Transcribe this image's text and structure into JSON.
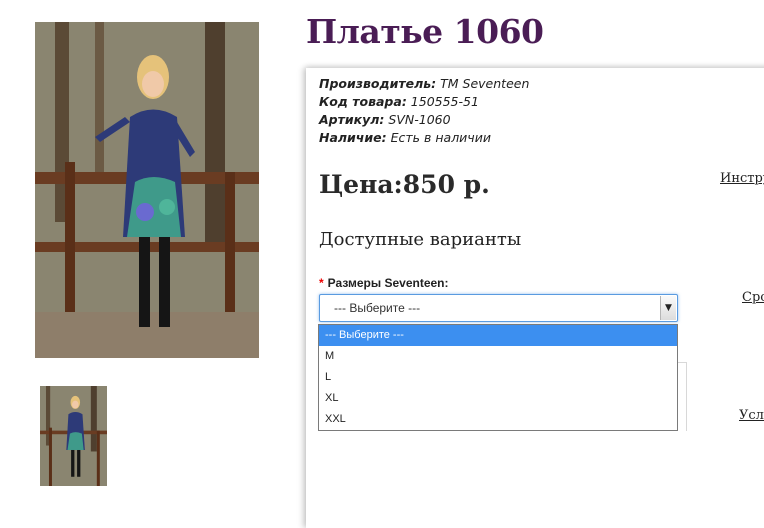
{
  "product": {
    "title": "Платье 1060",
    "meta": [
      {
        "label": "Производитель:",
        "value": "ТМ Seventeen"
      },
      {
        "label": "Код товара:",
        "value": "150555-51"
      },
      {
        "label": "Артикул:",
        "value": "SVN-1060"
      },
      {
        "label": "Наличие:",
        "value": "Есть в наличии"
      }
    ],
    "price": "Цена:850 р."
  },
  "side_links": {
    "instructions": "Инстру",
    "terms": "Сро",
    "conditions": "Усло"
  },
  "variants": {
    "title": "Доступные варианты",
    "required_mark": "*",
    "size_label": "Размеры Seventeen:",
    "selected_value": "--- Выберите ---",
    "options": [
      "--- Выберите ---",
      "M",
      "L",
      "XL",
      "XXL"
    ]
  },
  "icons": {
    "dropdown_arrow": "triangle-down"
  },
  "colors": {
    "title": "#4a1d55",
    "selected_option_bg": "#3c8ff0",
    "required": "#e00000"
  }
}
